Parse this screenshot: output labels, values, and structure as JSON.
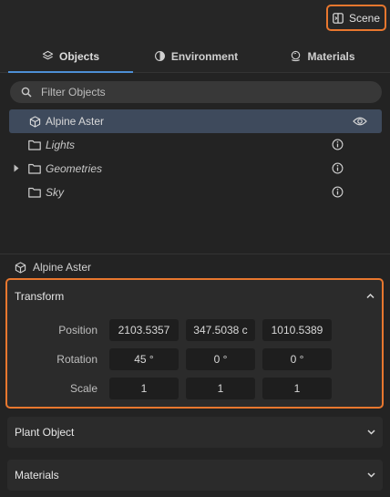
{
  "header": {
    "scene_label": "Scene"
  },
  "tabs": [
    {
      "label": "Objects",
      "icon": "layers-icon",
      "active": true
    },
    {
      "label": "Environment",
      "icon": "environment-icon",
      "active": false
    },
    {
      "label": "Materials",
      "icon": "material-icon",
      "active": false
    }
  ],
  "filter": {
    "placeholder": "Filter Objects"
  },
  "tree": [
    {
      "label": "Alpine Aster",
      "type": "object",
      "selected": true
    },
    {
      "label": "Lights",
      "type": "folder"
    },
    {
      "label": "Geometries",
      "type": "folder",
      "expandable": true
    },
    {
      "label": "Sky",
      "type": "folder"
    }
  ],
  "selection": {
    "name": "Alpine Aster"
  },
  "transform": {
    "title": "Transform",
    "position_label": "Position",
    "rotation_label": "Rotation",
    "scale_label": "Scale",
    "position": [
      "2103.5357",
      "347.5038 c",
      "1010.5389"
    ],
    "rotation": [
      "45 °",
      "0 °",
      "0 °"
    ],
    "scale": [
      "1",
      "1",
      "1"
    ]
  },
  "plant_object": {
    "title": "Plant Object"
  },
  "materials": {
    "title": "Materials"
  },
  "colors": {
    "accent": "#4d8fd6",
    "highlight": "#e8772e",
    "selected_row": "#3e4a5c"
  }
}
